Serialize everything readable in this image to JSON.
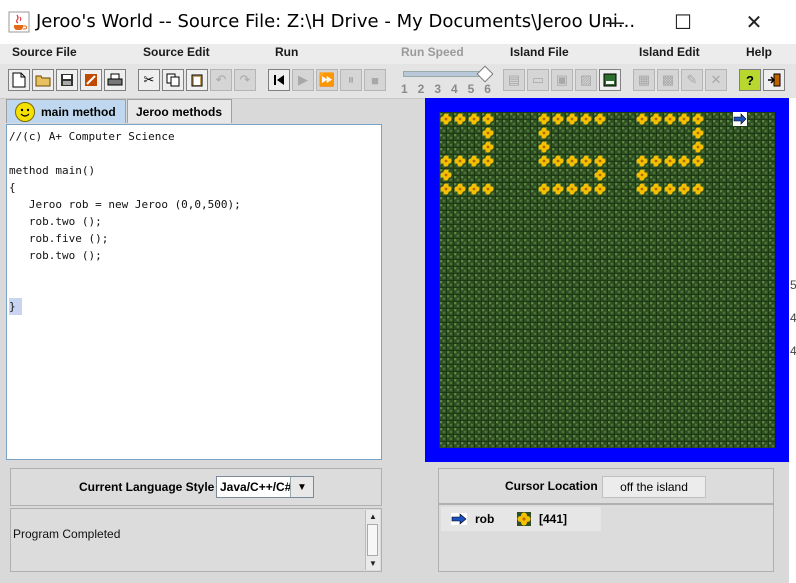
{
  "window": {
    "title": "Jeroo's World -- Source File: Z:\\H Drive - My Documents\\Jeroo Uni...",
    "controls": {
      "minimize": "—",
      "maximize": "☐",
      "close": "✕"
    }
  },
  "menus": {
    "source_file": "Source File",
    "source_edit": "Source Edit",
    "run": "Run",
    "run_speed": "Run Speed",
    "island_file": "Island File",
    "island_edit": "Island Edit",
    "help": "Help"
  },
  "toolbar": {
    "speed_labels": [
      "1",
      "2",
      "3",
      "4",
      "5",
      "6"
    ],
    "speed_value": 6
  },
  "tabs": {
    "main": "main method",
    "methods": "Jeroo methods"
  },
  "editor": {
    "lines": [
      "//(c) A+ Computer Science",
      "",
      "method main()",
      "{",
      "   Jeroo rob = new Jeroo (0,0,500);",
      "   rob.two ();",
      "   rob.five ();",
      "   rob.two ();",
      "",
      "",
      "}"
    ]
  },
  "language": {
    "label": "Current Language Style",
    "value": "Java/C++/C#"
  },
  "messages": {
    "text": "Program Completed"
  },
  "cursor": {
    "label": "Cursor Location",
    "value": "off the island"
  },
  "status": {
    "jeroo_name": "rob",
    "flowers": "[441]"
  },
  "gutter": [
    "5",
    "4",
    "4"
  ],
  "colors": {
    "water": "#0000ff",
    "grass": "#2e4d22",
    "flower": "#f5c000",
    "tab_active": "#bfd8ef"
  },
  "island": {
    "flowers": [
      [
        0,
        0
      ],
      [
        1,
        0
      ],
      [
        2,
        0
      ],
      [
        3,
        0
      ],
      [
        3,
        1
      ],
      [
        3,
        2
      ],
      [
        0,
        3
      ],
      [
        1,
        3
      ],
      [
        2,
        3
      ],
      [
        3,
        3
      ],
      [
        0,
        4
      ],
      [
        0,
        5
      ],
      [
        1,
        5
      ],
      [
        2,
        5
      ],
      [
        3,
        5
      ],
      [
        7,
        0
      ],
      [
        8,
        0
      ],
      [
        9,
        0
      ],
      [
        10,
        0
      ],
      [
        11,
        0
      ],
      [
        7,
        1
      ],
      [
        7,
        2
      ],
      [
        7,
        3
      ],
      [
        8,
        3
      ],
      [
        9,
        3
      ],
      [
        10,
        3
      ],
      [
        11,
        3
      ],
      [
        11,
        4
      ],
      [
        11,
        5
      ],
      [
        7,
        5
      ],
      [
        8,
        5
      ],
      [
        9,
        5
      ],
      [
        10,
        5
      ],
      [
        14,
        0
      ],
      [
        15,
        0
      ],
      [
        16,
        0
      ],
      [
        17,
        0
      ],
      [
        18,
        0
      ],
      [
        18,
        1
      ],
      [
        18,
        2
      ],
      [
        18,
        3
      ],
      [
        17,
        3
      ],
      [
        16,
        3
      ],
      [
        15,
        3
      ],
      [
        14,
        3
      ],
      [
        14,
        4
      ],
      [
        14,
        5
      ],
      [
        15,
        5
      ],
      [
        16,
        5
      ],
      [
        17,
        5
      ],
      [
        18,
        5
      ]
    ],
    "jeroo": {
      "col": 21,
      "row": 0,
      "facing": "east"
    }
  }
}
